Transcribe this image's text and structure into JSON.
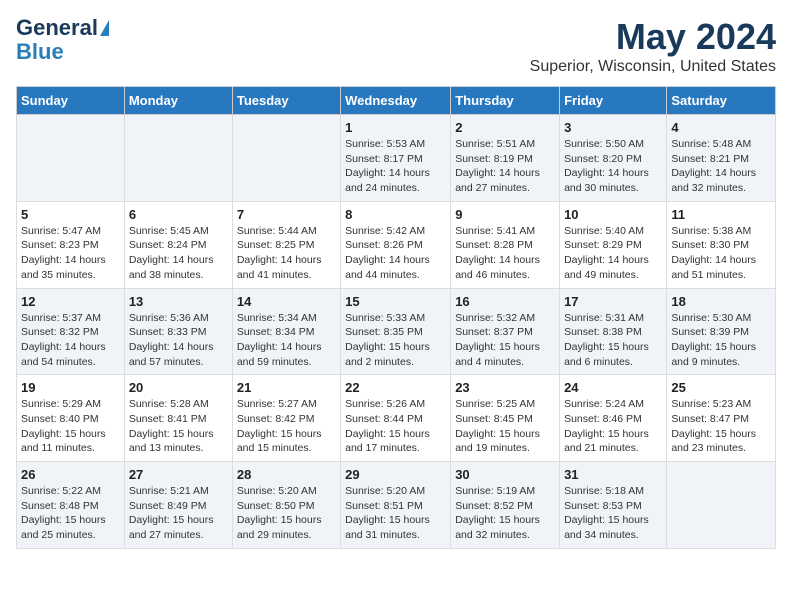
{
  "header": {
    "logo_line1": "General",
    "logo_line2": "Blue",
    "month_title": "May 2024",
    "location": "Superior, Wisconsin, United States"
  },
  "weekdays": [
    "Sunday",
    "Monday",
    "Tuesday",
    "Wednesday",
    "Thursday",
    "Friday",
    "Saturday"
  ],
  "weeks": [
    [
      {
        "num": "",
        "sunrise": "",
        "sunset": "",
        "daylight": ""
      },
      {
        "num": "",
        "sunrise": "",
        "sunset": "",
        "daylight": ""
      },
      {
        "num": "",
        "sunrise": "",
        "sunset": "",
        "daylight": ""
      },
      {
        "num": "1",
        "sunrise": "Sunrise: 5:53 AM",
        "sunset": "Sunset: 8:17 PM",
        "daylight": "Daylight: 14 hours and 24 minutes."
      },
      {
        "num": "2",
        "sunrise": "Sunrise: 5:51 AM",
        "sunset": "Sunset: 8:19 PM",
        "daylight": "Daylight: 14 hours and 27 minutes."
      },
      {
        "num": "3",
        "sunrise": "Sunrise: 5:50 AM",
        "sunset": "Sunset: 8:20 PM",
        "daylight": "Daylight: 14 hours and 30 minutes."
      },
      {
        "num": "4",
        "sunrise": "Sunrise: 5:48 AM",
        "sunset": "Sunset: 8:21 PM",
        "daylight": "Daylight: 14 hours and 32 minutes."
      }
    ],
    [
      {
        "num": "5",
        "sunrise": "Sunrise: 5:47 AM",
        "sunset": "Sunset: 8:23 PM",
        "daylight": "Daylight: 14 hours and 35 minutes."
      },
      {
        "num": "6",
        "sunrise": "Sunrise: 5:45 AM",
        "sunset": "Sunset: 8:24 PM",
        "daylight": "Daylight: 14 hours and 38 minutes."
      },
      {
        "num": "7",
        "sunrise": "Sunrise: 5:44 AM",
        "sunset": "Sunset: 8:25 PM",
        "daylight": "Daylight: 14 hours and 41 minutes."
      },
      {
        "num": "8",
        "sunrise": "Sunrise: 5:42 AM",
        "sunset": "Sunset: 8:26 PM",
        "daylight": "Daylight: 14 hours and 44 minutes."
      },
      {
        "num": "9",
        "sunrise": "Sunrise: 5:41 AM",
        "sunset": "Sunset: 8:28 PM",
        "daylight": "Daylight: 14 hours and 46 minutes."
      },
      {
        "num": "10",
        "sunrise": "Sunrise: 5:40 AM",
        "sunset": "Sunset: 8:29 PM",
        "daylight": "Daylight: 14 hours and 49 minutes."
      },
      {
        "num": "11",
        "sunrise": "Sunrise: 5:38 AM",
        "sunset": "Sunset: 8:30 PM",
        "daylight": "Daylight: 14 hours and 51 minutes."
      }
    ],
    [
      {
        "num": "12",
        "sunrise": "Sunrise: 5:37 AM",
        "sunset": "Sunset: 8:32 PM",
        "daylight": "Daylight: 14 hours and 54 minutes."
      },
      {
        "num": "13",
        "sunrise": "Sunrise: 5:36 AM",
        "sunset": "Sunset: 8:33 PM",
        "daylight": "Daylight: 14 hours and 57 minutes."
      },
      {
        "num": "14",
        "sunrise": "Sunrise: 5:34 AM",
        "sunset": "Sunset: 8:34 PM",
        "daylight": "Daylight: 14 hours and 59 minutes."
      },
      {
        "num": "15",
        "sunrise": "Sunrise: 5:33 AM",
        "sunset": "Sunset: 8:35 PM",
        "daylight": "Daylight: 15 hours and 2 minutes."
      },
      {
        "num": "16",
        "sunrise": "Sunrise: 5:32 AM",
        "sunset": "Sunset: 8:37 PM",
        "daylight": "Daylight: 15 hours and 4 minutes."
      },
      {
        "num": "17",
        "sunrise": "Sunrise: 5:31 AM",
        "sunset": "Sunset: 8:38 PM",
        "daylight": "Daylight: 15 hours and 6 minutes."
      },
      {
        "num": "18",
        "sunrise": "Sunrise: 5:30 AM",
        "sunset": "Sunset: 8:39 PM",
        "daylight": "Daylight: 15 hours and 9 minutes."
      }
    ],
    [
      {
        "num": "19",
        "sunrise": "Sunrise: 5:29 AM",
        "sunset": "Sunset: 8:40 PM",
        "daylight": "Daylight: 15 hours and 11 minutes."
      },
      {
        "num": "20",
        "sunrise": "Sunrise: 5:28 AM",
        "sunset": "Sunset: 8:41 PM",
        "daylight": "Daylight: 15 hours and 13 minutes."
      },
      {
        "num": "21",
        "sunrise": "Sunrise: 5:27 AM",
        "sunset": "Sunset: 8:42 PM",
        "daylight": "Daylight: 15 hours and 15 minutes."
      },
      {
        "num": "22",
        "sunrise": "Sunrise: 5:26 AM",
        "sunset": "Sunset: 8:44 PM",
        "daylight": "Daylight: 15 hours and 17 minutes."
      },
      {
        "num": "23",
        "sunrise": "Sunrise: 5:25 AM",
        "sunset": "Sunset: 8:45 PM",
        "daylight": "Daylight: 15 hours and 19 minutes."
      },
      {
        "num": "24",
        "sunrise": "Sunrise: 5:24 AM",
        "sunset": "Sunset: 8:46 PM",
        "daylight": "Daylight: 15 hours and 21 minutes."
      },
      {
        "num": "25",
        "sunrise": "Sunrise: 5:23 AM",
        "sunset": "Sunset: 8:47 PM",
        "daylight": "Daylight: 15 hours and 23 minutes."
      }
    ],
    [
      {
        "num": "26",
        "sunrise": "Sunrise: 5:22 AM",
        "sunset": "Sunset: 8:48 PM",
        "daylight": "Daylight: 15 hours and 25 minutes."
      },
      {
        "num": "27",
        "sunrise": "Sunrise: 5:21 AM",
        "sunset": "Sunset: 8:49 PM",
        "daylight": "Daylight: 15 hours and 27 minutes."
      },
      {
        "num": "28",
        "sunrise": "Sunrise: 5:20 AM",
        "sunset": "Sunset: 8:50 PM",
        "daylight": "Daylight: 15 hours and 29 minutes."
      },
      {
        "num": "29",
        "sunrise": "Sunrise: 5:20 AM",
        "sunset": "Sunset: 8:51 PM",
        "daylight": "Daylight: 15 hours and 31 minutes."
      },
      {
        "num": "30",
        "sunrise": "Sunrise: 5:19 AM",
        "sunset": "Sunset: 8:52 PM",
        "daylight": "Daylight: 15 hours and 32 minutes."
      },
      {
        "num": "31",
        "sunrise": "Sunrise: 5:18 AM",
        "sunset": "Sunset: 8:53 PM",
        "daylight": "Daylight: 15 hours and 34 minutes."
      },
      {
        "num": "",
        "sunrise": "",
        "sunset": "",
        "daylight": ""
      }
    ]
  ]
}
